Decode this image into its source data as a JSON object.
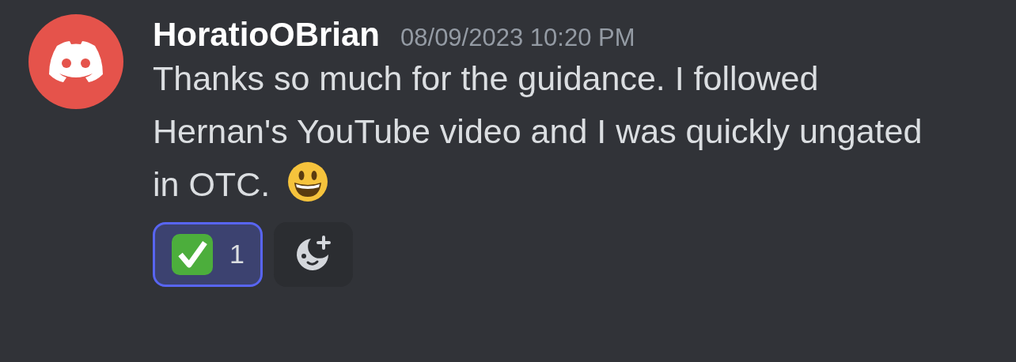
{
  "message": {
    "author": "HoratioOBrian",
    "timestamp": "08/09/2023 10:20 PM",
    "lines": [
      "Thanks so much for the guidance. I followed",
      "Hernan's YouTube video and I was quickly ungated",
      "in OTC."
    ],
    "trailing_emoji": true
  },
  "reactions": [
    {
      "kind": "emoji",
      "count": "1",
      "selected": true
    },
    {
      "kind": "add"
    }
  ]
}
